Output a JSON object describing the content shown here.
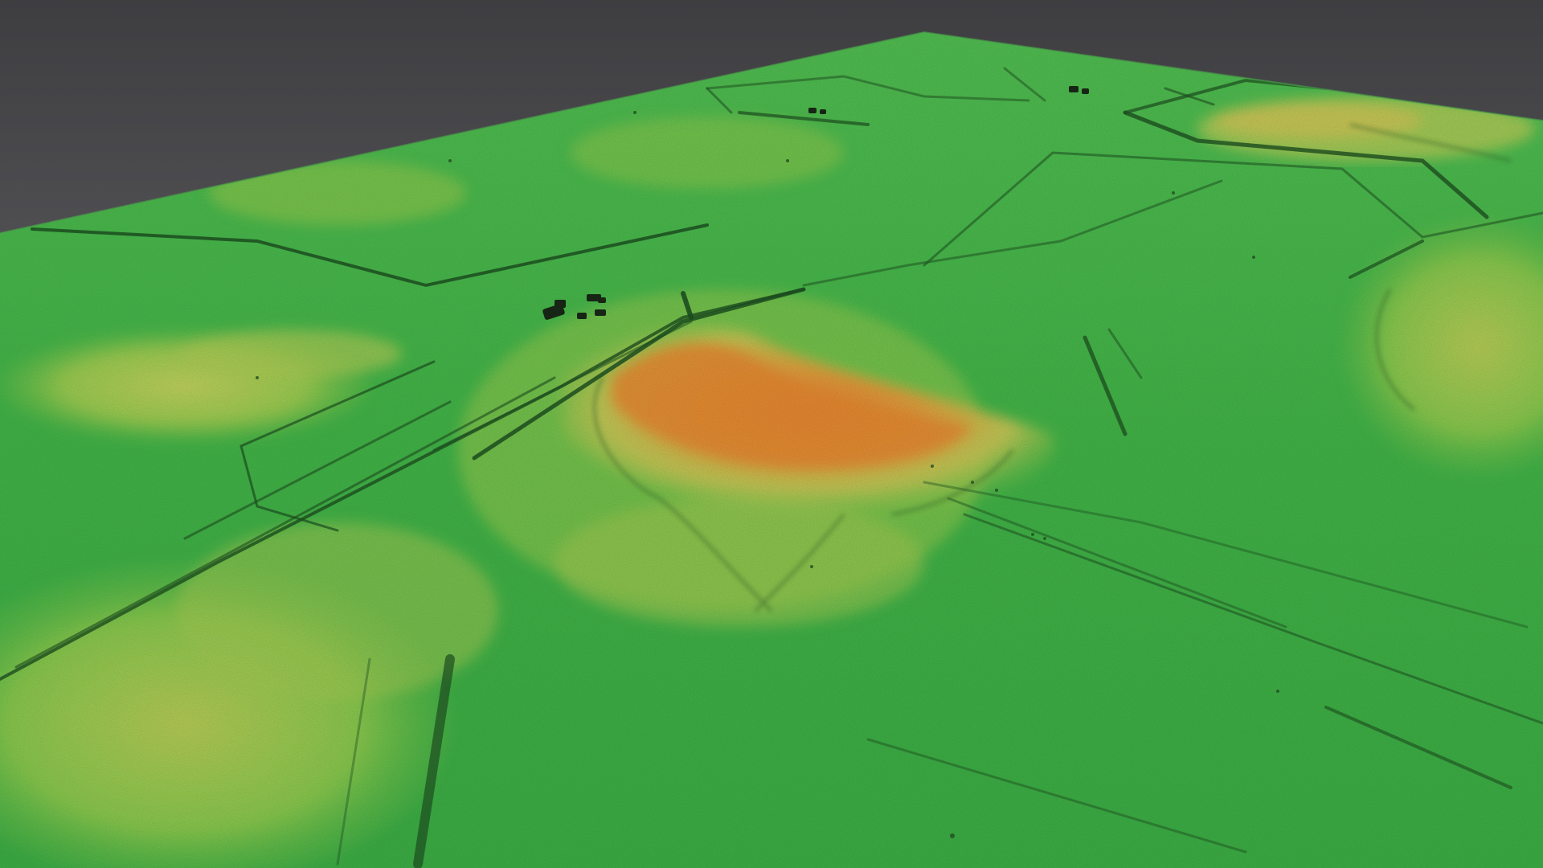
{
  "scene": {
    "kind": "3d-terrain-elevation-model",
    "background": "grey-gradient",
    "colors": {
      "sky_top": "#3e3e41",
      "sky_bottom": "#7b7b7f",
      "terrain_low": "#3cae45",
      "terrain_mid": "#6fc24a",
      "terrain_high": "#c6cd58",
      "terrain_peak": "#e88a3a",
      "ditch": "#1f4a22",
      "building": "#1a1f18"
    },
    "features": [
      {
        "name": "central-hill",
        "elevation_class": "high"
      },
      {
        "name": "left-mound",
        "elevation_class": "mid"
      },
      {
        "name": "far-right-ridge",
        "elevation_class": "mid"
      },
      {
        "name": "right-slope",
        "elevation_class": "mid"
      },
      {
        "name": "front-left-rise",
        "elevation_class": "mid"
      }
    ]
  }
}
